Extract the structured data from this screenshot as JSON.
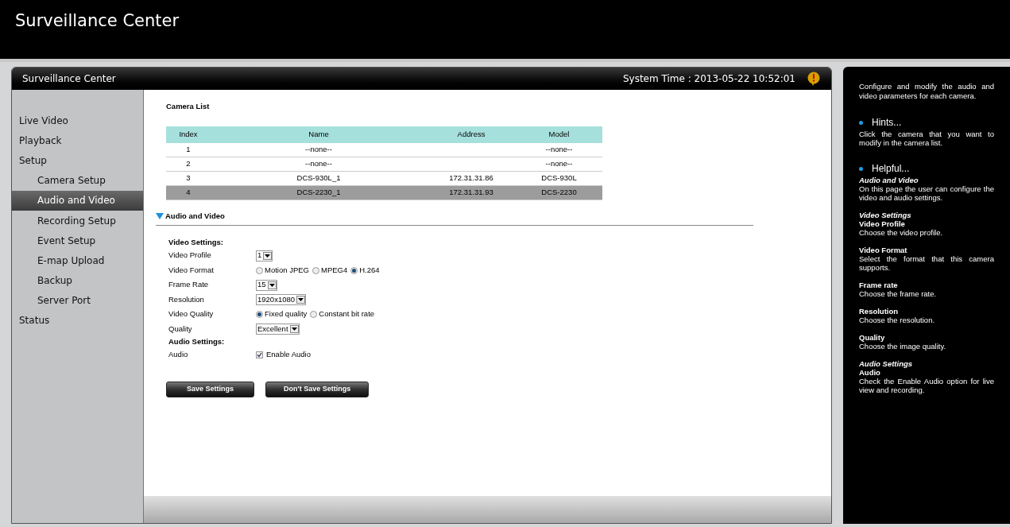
{
  "app_title": "Surveillance Center",
  "panel": {
    "title": "Surveillance Center",
    "system_time": "System Time : 2013-05-22 10:52:01"
  },
  "sidebar": {
    "items": [
      {
        "label": "Live Video",
        "selected": false
      },
      {
        "label": "Playback",
        "selected": false
      },
      {
        "label": "Setup",
        "selected": false,
        "children": [
          {
            "label": "Camera Setup",
            "selected": false
          },
          {
            "label": "Audio and Video",
            "selected": true
          },
          {
            "label": "Recording Setup",
            "selected": false
          },
          {
            "label": "Event Setup",
            "selected": false
          },
          {
            "label": "E-map Upload",
            "selected": false
          },
          {
            "label": "Backup",
            "selected": false
          },
          {
            "label": "Server Port",
            "selected": false
          }
        ]
      },
      {
        "label": "Status",
        "selected": false
      }
    ]
  },
  "camera_list": {
    "title": "Camera List",
    "columns": [
      "Index",
      "Name",
      "Address",
      "Model"
    ],
    "rows": [
      {
        "cells": [
          "1",
          "--none--",
          "",
          "--none--"
        ],
        "selected": false
      },
      {
        "cells": [
          "2",
          "--none--",
          "",
          "--none--"
        ],
        "selected": false
      },
      {
        "cells": [
          "3",
          "DCS-930L_1",
          "172.31.31.86",
          "DCS-930L"
        ],
        "selected": false
      },
      {
        "cells": [
          "4",
          "DCS-2230_1",
          "172.31.31.93",
          "DCS-2230"
        ],
        "selected": true
      }
    ]
  },
  "section": {
    "title": "Audio and Video",
    "expanded": true
  },
  "form": {
    "groups": [
      {
        "heading": "Video Settings:",
        "fields": [
          {
            "label": "Video Profile",
            "kind": "select",
            "value": "1"
          },
          {
            "label": "Video Format",
            "kind": "radio",
            "options": [
              {
                "label": "Motion JPEG",
                "selected": false
              },
              {
                "label": "MPEG4",
                "selected": false
              },
              {
                "label": "H.264",
                "selected": true
              }
            ]
          },
          {
            "label": "Frame Rate",
            "kind": "select",
            "value": "15"
          },
          {
            "label": "Resolution",
            "kind": "select",
            "value": "1920x1080"
          },
          {
            "label": "Video Quality",
            "kind": "radio",
            "options": [
              {
                "label": "Fixed quality",
                "selected": true
              },
              {
                "label": "Constant bit rate",
                "selected": false
              }
            ]
          },
          {
            "label": "Quality",
            "kind": "select",
            "value": "Excellent"
          }
        ]
      },
      {
        "heading": "Audio Settings:",
        "fields": [
          {
            "label": "Audio",
            "kind": "checkbox",
            "text": "Enable Audio",
            "checked": true
          }
        ]
      }
    ]
  },
  "buttons": [
    "Save Settings",
    "Don't Save Settings"
  ],
  "help": {
    "intro": "Configure and modify the audio and video parameters for each camera.",
    "sections": [
      {
        "title": "Hints...",
        "blocks": [
          [
            {
              "kind": "text",
              "text": "Click the camera that you want to modify in the camera list."
            }
          ]
        ]
      },
      {
        "title": "Helpful...",
        "blocks": [
          [
            {
              "kind": "subject",
              "text": "Audio and Video"
            },
            {
              "kind": "text",
              "text": "On this page the user can configure the video and audio settings."
            }
          ],
          [
            {
              "kind": "subject",
              "text": "Video Settings"
            },
            {
              "kind": "topic",
              "text": "Video Profile"
            },
            {
              "kind": "text",
              "text": "Choose the video profile."
            }
          ],
          [
            {
              "kind": "topic",
              "text": "Video Format"
            },
            {
              "kind": "text",
              "text": "Select the format that this camera supports."
            }
          ],
          [
            {
              "kind": "topic",
              "text": "Frame rate"
            },
            {
              "kind": "text",
              "text": "Choose the frame rate."
            }
          ],
          [
            {
              "kind": "topic",
              "text": "Resolution"
            },
            {
              "kind": "text",
              "text": "Choose the resolution."
            }
          ],
          [
            {
              "kind": "topic",
              "text": "Quality"
            },
            {
              "kind": "text",
              "text": "Choose the image quality."
            }
          ],
          [
            {
              "kind": "subject",
              "text": "Audio Settings"
            },
            {
              "kind": "topic",
              "text": "Audio"
            },
            {
              "kind": "text",
              "text": "Check the Enable Audio option for live view and recording."
            }
          ]
        ]
      }
    ]
  }
}
